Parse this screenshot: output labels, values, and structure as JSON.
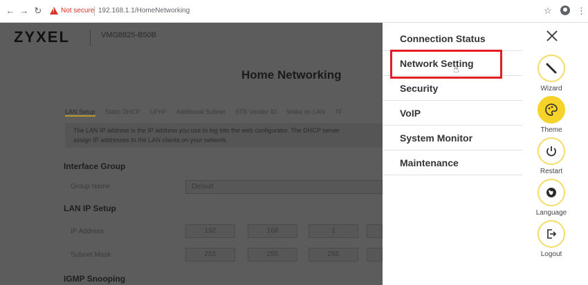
{
  "browser": {
    "back": "←",
    "forward": "→",
    "reload": "↻",
    "security_text": "Not secure",
    "url": "192.168.1.1/HomeNetworking",
    "star": "☆",
    "menu": "⋮"
  },
  "header": {
    "logo": "ZYXEL",
    "model": "VMG8825-B50B"
  },
  "page": {
    "title": "Home Networking",
    "tabs": [
      "LAN Setup",
      "Static DHCP",
      "UPnP",
      "Additional Subnet",
      "STB Vendor ID",
      "Wake on LAN",
      "TF"
    ],
    "info_line1": "The LAN IP address is the IP address you use to log into the web configurator. The DHCP server",
    "info_line2": "assign IP addresses to the LAN clients on your network.",
    "interface_group": "Interface Group",
    "group_name_label": "Group Name",
    "group_name_value": "Default",
    "lan_ip_setup": "LAN IP Setup",
    "ip_address_label": "IP Address",
    "ip": [
      "192",
      "168",
      "1",
      ""
    ],
    "subnet_mask_label": "Subnet Mask",
    "mask": [
      "255",
      "255",
      "255",
      ""
    ],
    "igmp_snooping": "IGMP Snooping"
  },
  "menu": {
    "items": [
      "Connection Status",
      "Network Setting",
      "Security",
      "VoIP",
      "System Monitor",
      "Maintenance"
    ]
  },
  "icons": {
    "wizard": "Wizard",
    "theme": "Theme",
    "restart": "Restart",
    "language": "Language",
    "logout": "Logout"
  },
  "colors": {
    "highlight": "#e41c23",
    "accent": "#f5d32a"
  }
}
